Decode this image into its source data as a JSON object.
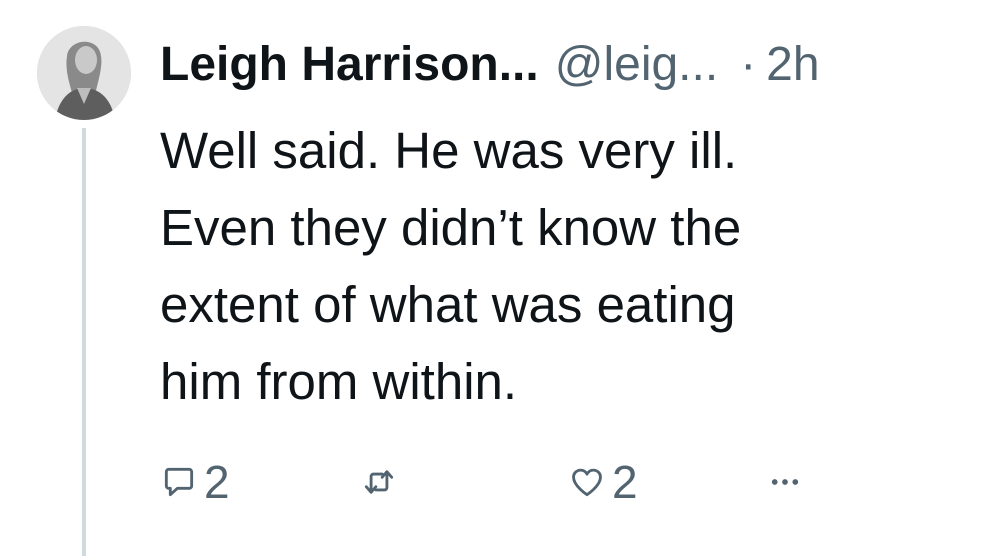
{
  "user": {
    "display_name": "Leigh Harrison...",
    "handle": "@leig...",
    "separator": "·",
    "time": "2h"
  },
  "tweet": {
    "lines": [
      "Well said. He was very ill.",
      "Even they didn’t know the",
      "extent of what was eating",
      "him from within."
    ]
  },
  "actions": {
    "reply_count": "2",
    "like_count": "2"
  },
  "icons": {
    "reply": "reply-icon",
    "retweet": "retweet-icon",
    "like": "heart-icon",
    "more": "more-icon"
  },
  "colors": {
    "text": "#0f1419",
    "secondary": "#536471",
    "thread_line": "#cfd9de"
  }
}
